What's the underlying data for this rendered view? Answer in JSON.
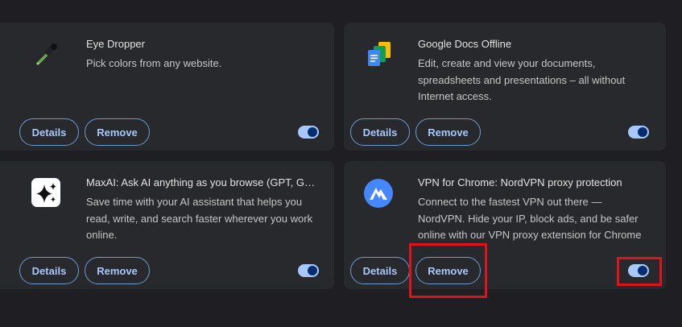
{
  "extensions": [
    {
      "icon": "eye-dropper-icon",
      "name": "Eye Dropper",
      "description": "Pick colors from any website.",
      "details_label": "Details",
      "remove_label": "Remove",
      "enabled": true
    },
    {
      "icon": "google-docs-offline-icon",
      "name": "Google Docs Offline",
      "description": "Edit, create and view your documents, spreadsheets and presentations – all without Internet access.",
      "details_label": "Details",
      "remove_label": "Remove",
      "enabled": true
    },
    {
      "icon": "maxai-sparkle-icon",
      "name": "MaxAI: Ask AI anything as you browse (GPT, Ge...",
      "description": "Save time with your AI assistant that helps you read, write, and search faster wherever you work online.",
      "details_label": "Details",
      "remove_label": "Remove",
      "enabled": true
    },
    {
      "icon": "nordvpn-icon",
      "name": "VPN for Chrome: NordVPN proxy protection",
      "description": "Connect to the fastest VPN out there — NordVPN. Hide your IP, block ads, and be safer online with our VPN proxy extension for Chrome",
      "details_label": "Details",
      "remove_label": "Remove",
      "enabled": true
    }
  ],
  "colors": {
    "page_bg": "#1f1f23",
    "card_bg": "#28292d",
    "accent": "#a8c7fa",
    "highlight": "#e0121c"
  },
  "highlights": [
    "remove-button-nordvpn",
    "toggle-nordvpn"
  ]
}
